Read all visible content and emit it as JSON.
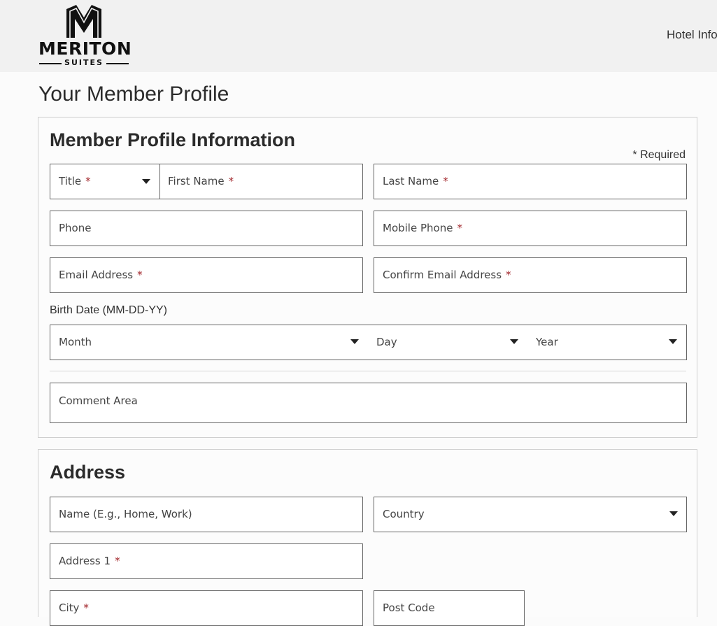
{
  "header": {
    "logo": {
      "wordmark": "MERITON",
      "sub": "SUITES"
    },
    "nav_link": "Hotel Info"
  },
  "page_title": "Your Member Profile",
  "profile": {
    "heading": "Member Profile Information",
    "required_note": "* Required",
    "fields": {
      "title": "Title",
      "first_name": "First Name",
      "last_name": "Last Name",
      "phone": "Phone",
      "mobile_phone": "Mobile Phone",
      "email": "Email Address",
      "confirm_email": "Confirm Email Address"
    },
    "birth_date": {
      "label": "Birth Date (MM-DD-YY)",
      "month": "Month",
      "day": "Day",
      "year": "Year"
    },
    "comment": "Comment Area",
    "required_mark": "*"
  },
  "address": {
    "heading": "Address",
    "fields": {
      "name": "Name (E.g., Home, Work)",
      "country": "Country",
      "address1": "Address 1",
      "city": "City",
      "post_code": "Post Code"
    }
  },
  "colors": {
    "required_star": "#a2262b",
    "header_bg": "#f1f1f1",
    "border": "#666666"
  }
}
